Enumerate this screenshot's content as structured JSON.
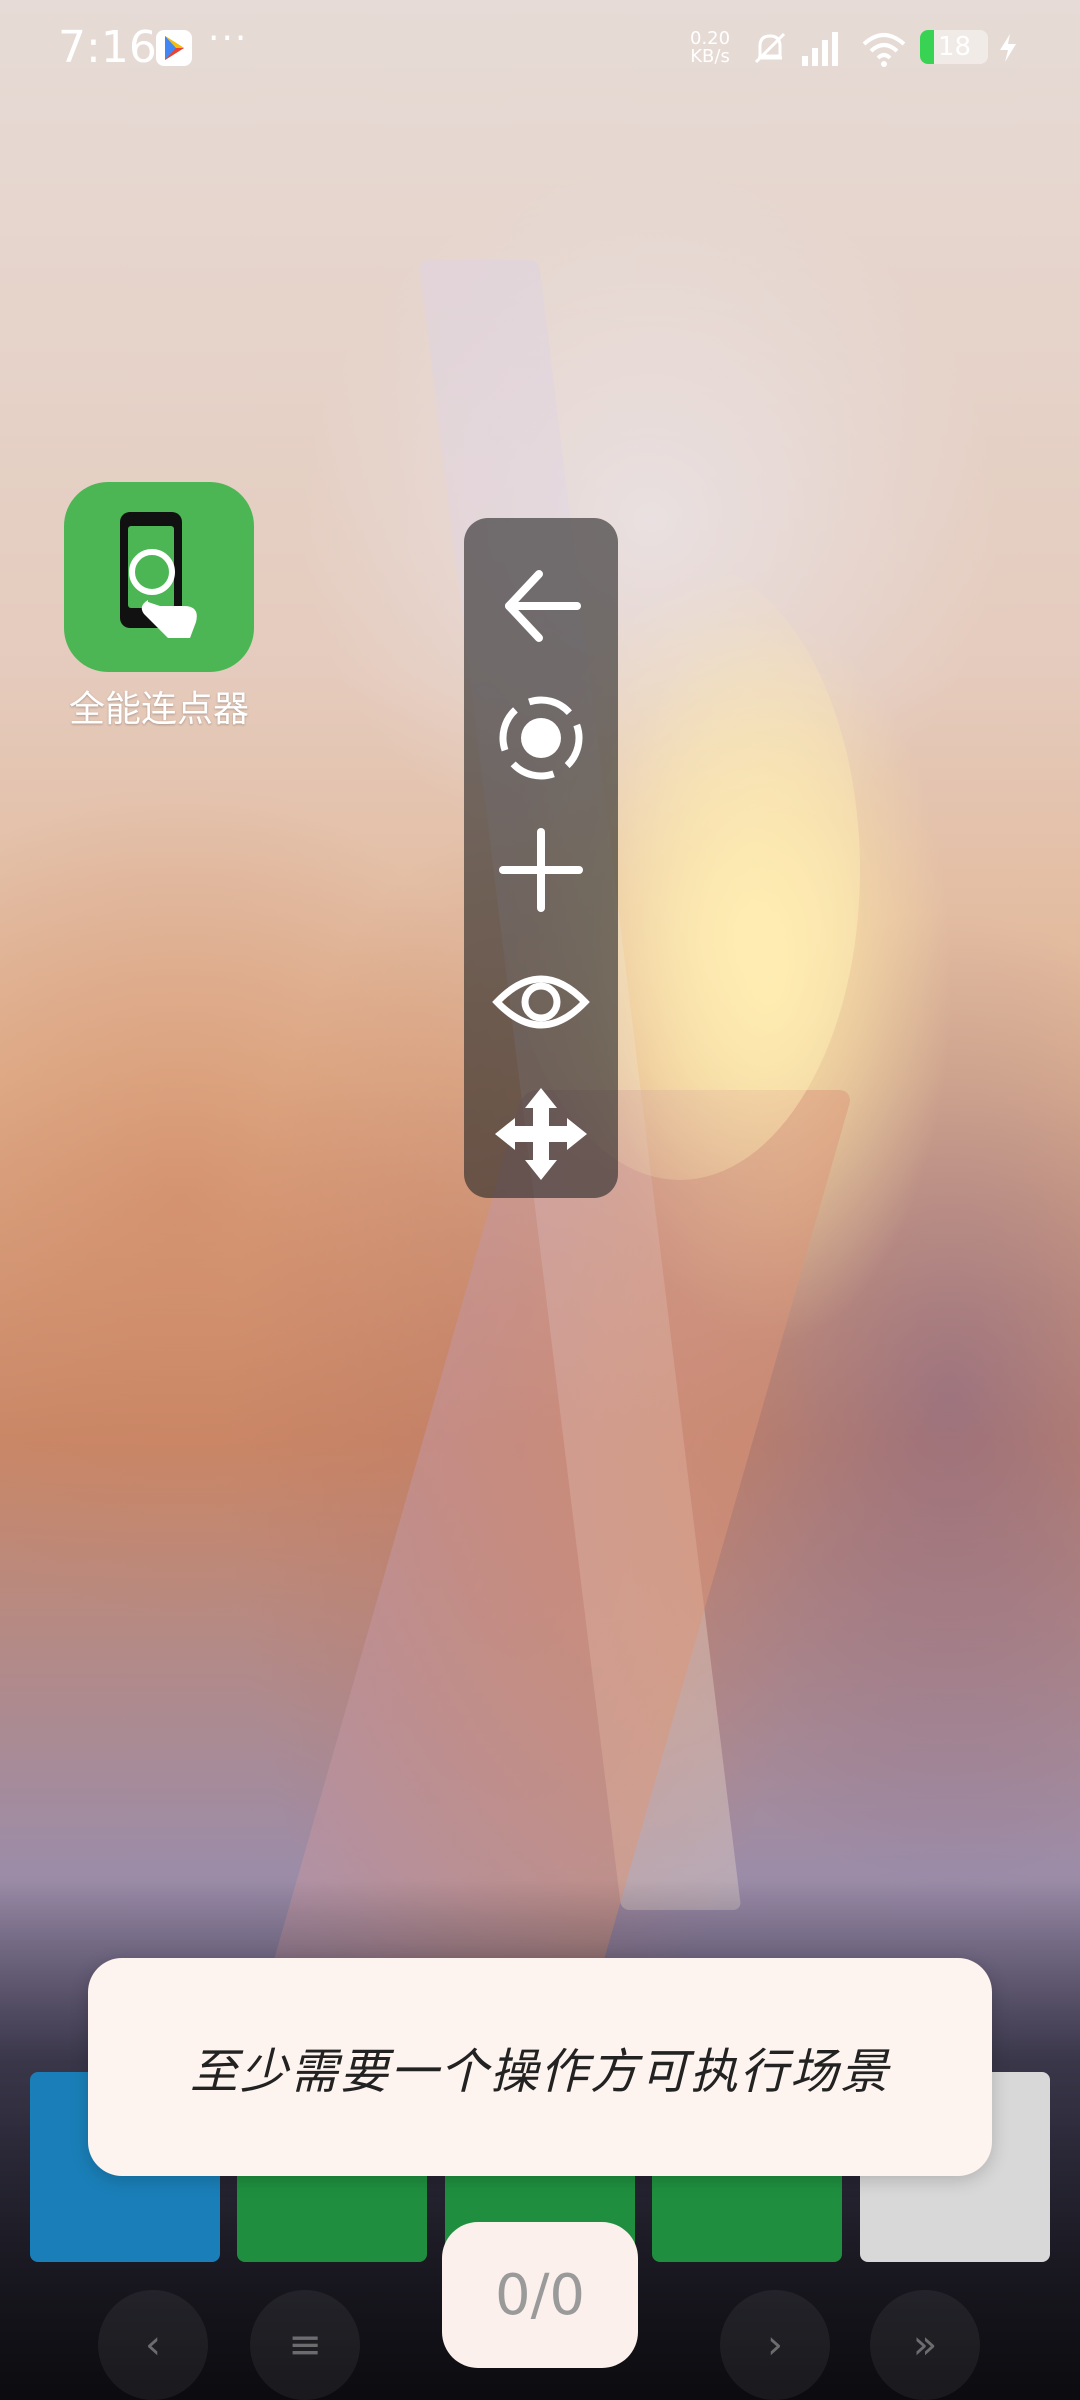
{
  "status_bar": {
    "time": "7:16",
    "more": "···",
    "net_speed_value": "0.20",
    "net_speed_unit": "KB/s",
    "battery_level": "18",
    "icons": [
      "google-play-icon",
      "mute-bell-icon",
      "signal-icon",
      "wifi-icon",
      "battery-icon",
      "charging-bolt-icon"
    ]
  },
  "home": {
    "app_label": "全能连点器"
  },
  "toolbar": {
    "buttons": [
      "back-arrow-icon",
      "record-target-icon",
      "add-icon",
      "eye-icon",
      "move-arrows-icon"
    ]
  },
  "toast": {
    "message": "至少需要一个操作方可执行场景"
  },
  "counter": {
    "value": "0/0"
  },
  "colors": {
    "app_green": "#4bb653",
    "toast_bg": "#fdf3ef",
    "toolbar_bg": "rgba(40,40,40,0.62)"
  }
}
